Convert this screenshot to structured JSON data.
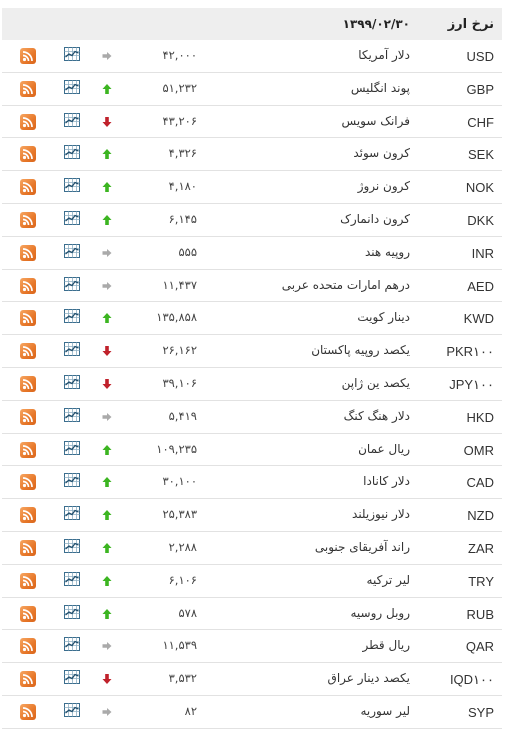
{
  "header": {
    "title": "نرخ ارز",
    "date": "۱۳۹۹/۰۲/۳۰"
  },
  "colors": {
    "up": "#3cb521",
    "down": "#c0212b",
    "same": "#aaaaaa",
    "rss": "#e7782a",
    "chart": "#3b6e8e"
  },
  "rows": [
    {
      "code": "USD",
      "name": "دلار آمریکا",
      "price": "۴۲,۰۰۰",
      "trend": "same"
    },
    {
      "code": "GBP",
      "name": "پوند انگلیس",
      "price": "۵۱,۲۳۲",
      "trend": "up"
    },
    {
      "code": "CHF",
      "name": "فرانک سویس",
      "price": "۴۳,۲۰۶",
      "trend": "down"
    },
    {
      "code": "SEK",
      "name": "کرون سوئد",
      "price": "۴,۳۲۶",
      "trend": "up"
    },
    {
      "code": "NOK",
      "name": "کرون نروژ",
      "price": "۴,۱۸۰",
      "trend": "up"
    },
    {
      "code": "DKK",
      "name": "کرون دانمارک",
      "price": "۶,۱۴۵",
      "trend": "up"
    },
    {
      "code": "INR",
      "name": "روپیه هند",
      "price": "۵۵۵",
      "trend": "same"
    },
    {
      "code": "AED",
      "name": "درهم امارات متحده عربی",
      "price": "۱۱,۴۳۷",
      "trend": "same"
    },
    {
      "code": "KWD",
      "name": "دینار کویت",
      "price": "۱۳۵,۸۵۸",
      "trend": "up"
    },
    {
      "code": "PKR۱۰۰",
      "name": "یکصد روپیه پاکستان",
      "price": "۲۶,۱۶۲",
      "trend": "down"
    },
    {
      "code": "JPY۱۰۰",
      "name": "یکصد ین ژاپن",
      "price": "۳۹,۱۰۶",
      "trend": "down"
    },
    {
      "code": "HKD",
      "name": "دلار هنگ کنگ",
      "price": "۵,۴۱۹",
      "trend": "same"
    },
    {
      "code": "OMR",
      "name": "ریال عمان",
      "price": "۱۰۹,۲۳۵",
      "trend": "up"
    },
    {
      "code": "CAD",
      "name": "دلار کانادا",
      "price": "۳۰,۱۰۰",
      "trend": "up"
    },
    {
      "code": "NZD",
      "name": "دلار نیوزیلند",
      "price": "۲۵,۳۸۳",
      "trend": "up"
    },
    {
      "code": "ZAR",
      "name": "راند آفریقای جنوبی",
      "price": "۲,۲۸۸",
      "trend": "up"
    },
    {
      "code": "TRY",
      "name": "لیر ترکیه",
      "price": "۶,۱۰۶",
      "trend": "up"
    },
    {
      "code": "RUB",
      "name": "روبل روسیه",
      "price": "۵۷۸",
      "trend": "up"
    },
    {
      "code": "QAR",
      "name": "ریال قطر",
      "price": "۱۱,۵۳۹",
      "trend": "same"
    },
    {
      "code": "IQD۱۰۰",
      "name": "یکصد دینار عراق",
      "price": "۳,۵۳۲",
      "trend": "down"
    },
    {
      "code": "SYP",
      "name": "لیر سوریه",
      "price": "۸۲",
      "trend": "same"
    }
  ]
}
